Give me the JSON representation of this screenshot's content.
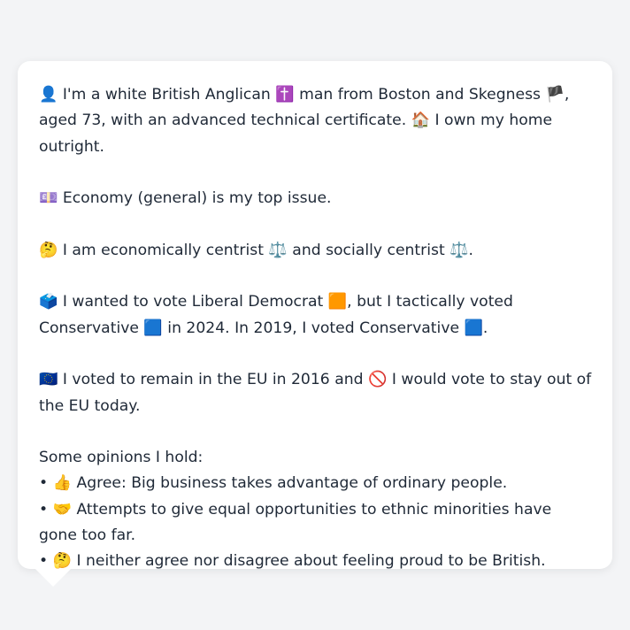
{
  "message": {
    "p1": "👤 I'm a white British Anglican ✝️ man from Boston and Skegness 🏴, aged 73, with an advanced technical certificate. 🏠 I own my home outright.",
    "p2": "💷 Economy (general) is my top issue.",
    "p3": "🤔 I am economically centrist ⚖️ and socially centrist ⚖️.",
    "p4": "🗳️ I wanted to vote Liberal Democrat 🟧, but I tactically voted Conservative 🟦 in 2024. In 2019, I voted Conservative 🟦.",
    "p5": "🇪🇺 I voted to remain in the EU in 2016 and 🚫 I would vote to stay out of the EU today.",
    "opinions_heading": "Some opinions I hold:",
    "opinions": [
      "• 👍 Agree: Big business takes advantage of ordinary people.",
      "• 🤝 Attempts to give equal opportunities to ethnic minorities have gone too far.",
      "• 🤔 I neither agree nor disagree about feeling proud to be British."
    ]
  },
  "colors": {
    "background": "#f3f4f6",
    "card": "#ffffff",
    "text": "#1f2937"
  }
}
